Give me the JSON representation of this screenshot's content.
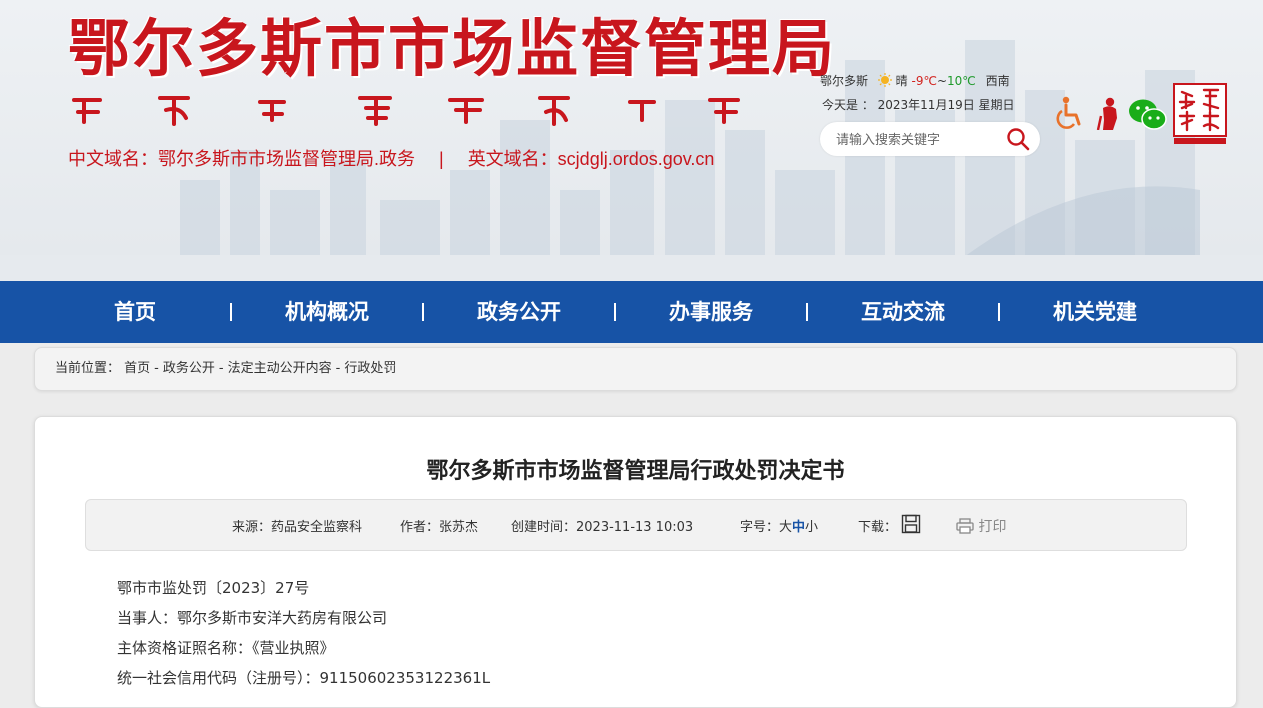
{
  "header": {
    "site_title": "鄂尔多斯市市场监督管理局",
    "domains": {
      "cn": "中文域名：鄂尔多斯市市场监督管理局.政务",
      "separator": "|",
      "en": "英文域名：scjdglj.ordos.gov.cn"
    },
    "weather": {
      "city": "鄂尔多斯",
      "condition": "晴",
      "low": "-9℃",
      "tilde": "~",
      "high": "10℃",
      "wind": "西南"
    },
    "today": "今天是 ： 2023年11月19日 星期日",
    "search": {
      "placeholder": "请输入搜索关键字"
    },
    "icons": [
      "accessibility-icon",
      "elderly-mode-icon",
      "wechat-icon"
    ],
    "colors": {
      "brand_red": "#c8161d",
      "nav_blue": "#1753a6"
    }
  },
  "nav": {
    "items": [
      {
        "label": "首页"
      },
      {
        "label": "机构概况"
      },
      {
        "label": "政务公开"
      },
      {
        "label": "办事服务"
      },
      {
        "label": "互动交流"
      },
      {
        "label": "机关党建"
      }
    ]
  },
  "breadcrumb": {
    "prefix": "当前位置：",
    "items": [
      "首页",
      "政务公开",
      "法定主动公开内容",
      "行政处罚"
    ],
    "dash": "-"
  },
  "article": {
    "title": "鄂尔多斯市市场监督管理局行政处罚决定书",
    "meta": {
      "source": "来源：药品安全监察科",
      "author": "作者：张苏杰",
      "created": "创建时间：2023-11-13 10:03",
      "font_size_label": "字号：",
      "size_large": "大",
      "size_medium": "中",
      "size_small": "小",
      "download_label": "下载：",
      "print_label": "打印"
    },
    "lines": [
      "鄂市市监处罚〔2023〕27号",
      "当事人：鄂尔多斯市安洋大药房有限公司",
      "主体资格证照名称：《营业执照》",
      "统一社会信用代码（注册号）：91150602353122361L"
    ]
  }
}
